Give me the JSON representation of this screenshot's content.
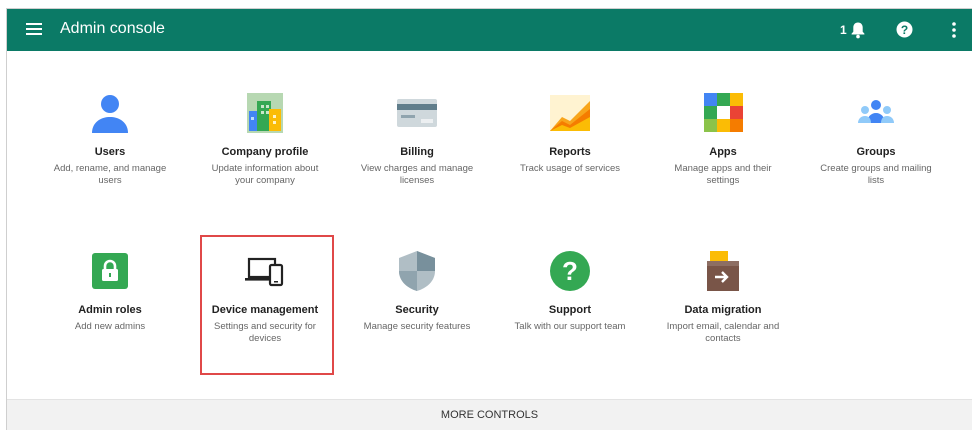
{
  "header": {
    "title": "Admin console",
    "notification_count": "1",
    "background_color": "#0b7a66"
  },
  "tiles": [
    {
      "title": "Users",
      "description": "Add, rename, and manage users",
      "icon": "users-icon"
    },
    {
      "title": "Company profile",
      "description": "Update information about your company",
      "icon": "company-profile-icon"
    },
    {
      "title": "Billing",
      "description": "View charges and manage licenses",
      "icon": "billing-icon"
    },
    {
      "title": "Reports",
      "description": "Track usage of services",
      "icon": "reports-icon"
    },
    {
      "title": "Apps",
      "description": "Manage apps and their settings",
      "icon": "apps-icon"
    },
    {
      "title": "Groups",
      "description": "Create groups and mailing lists",
      "icon": "groups-icon"
    },
    {
      "title": "Admin roles",
      "description": "Add new admins",
      "icon": "admin-roles-icon"
    },
    {
      "title": "Device management",
      "description": "Settings and security for devices",
      "icon": "device-management-icon"
    },
    {
      "title": "Security",
      "description": "Manage security features",
      "icon": "security-icon"
    },
    {
      "title": "Support",
      "description": "Talk with our support team",
      "icon": "support-icon"
    },
    {
      "title": "Data migration",
      "description": "Import email, calendar and contacts",
      "icon": "data-migration-icon"
    }
  ],
  "footer": {
    "more_controls_label": "MORE CONTROLS"
  },
  "highlight": {
    "target": "Device management",
    "color": "#e04848"
  }
}
